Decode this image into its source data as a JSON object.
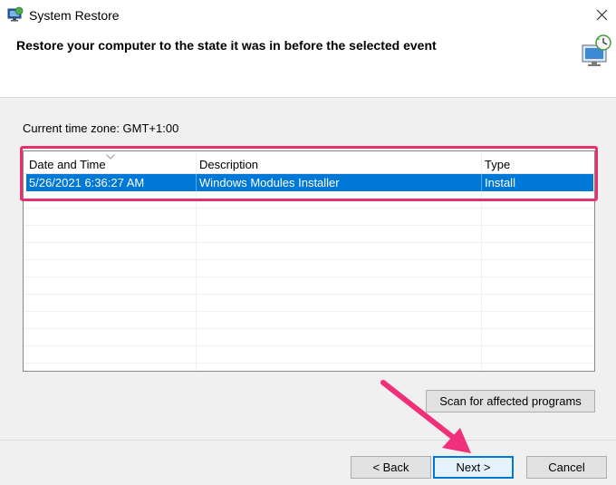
{
  "window": {
    "title": "System Restore",
    "app_icon": "system-restore-icon",
    "close_icon": "close-icon"
  },
  "header": {
    "heading": "Restore your computer to the state it was in before the selected event",
    "icon": "monitor-restore-icon"
  },
  "timezone_label": "Current time zone: GMT+1:00",
  "table": {
    "columns": [
      "Date and Time",
      "Description",
      "Type"
    ],
    "sort_indicator": "chevron-down-icon",
    "rows": [
      {
        "date": "5/26/2021 6:36:27 AM",
        "description": "Windows Modules Installer",
        "type": "Install",
        "selected": true
      }
    ]
  },
  "buttons": {
    "scan": "Scan for affected programs",
    "back": "< Back",
    "next": "Next >",
    "cancel": "Cancel"
  },
  "annotation": {
    "highlight_color": "#e8306a",
    "arrow_color": "#f0307a"
  },
  "colors": {
    "selection": "#0078d7",
    "body_bg": "#f0f0f0"
  }
}
